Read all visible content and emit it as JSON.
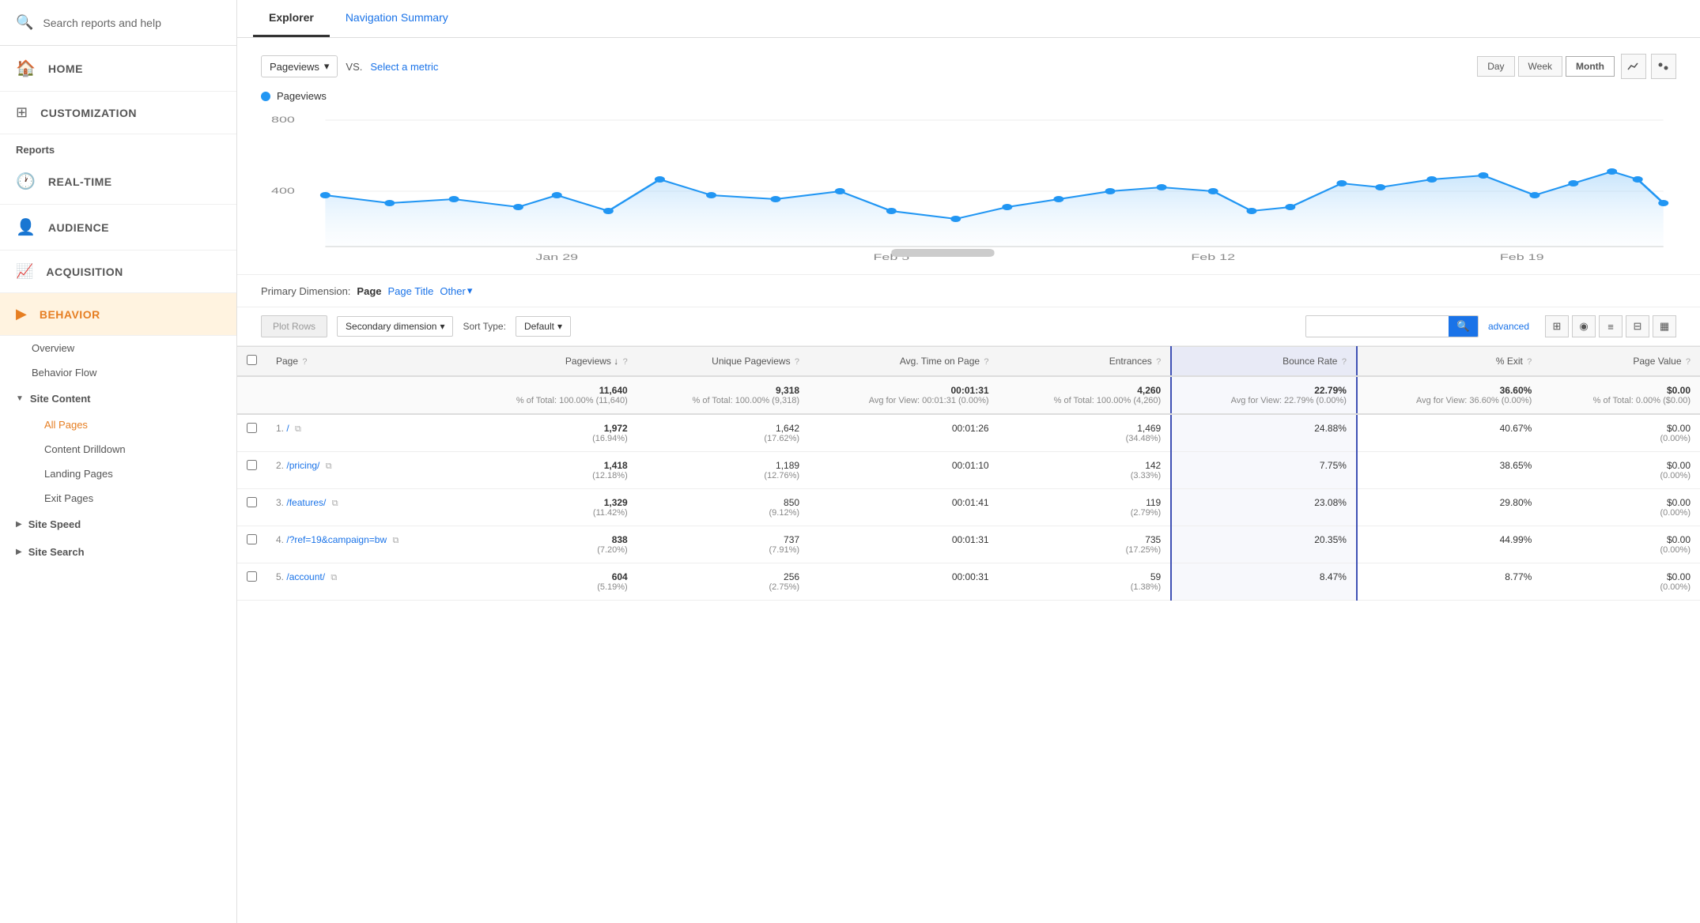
{
  "sidebar": {
    "search_placeholder": "Search reports and help",
    "nav_items": [
      {
        "id": "home",
        "label": "HOME",
        "icon": "🏠"
      },
      {
        "id": "customization",
        "label": "CUSTOMIZATION",
        "icon": "⊞"
      }
    ],
    "reports_label": "Reports",
    "report_sections": [
      {
        "id": "realtime",
        "label": "REAL-TIME",
        "icon": "🕐",
        "indent": 1
      },
      {
        "id": "audience",
        "label": "AUDIENCE",
        "icon": "👤",
        "indent": 1
      },
      {
        "id": "acquisition",
        "label": "ACQUISITION",
        "icon": "📈",
        "indent": 1
      },
      {
        "id": "behavior",
        "label": "BEHAVIOR",
        "icon": "▶",
        "indent": 1,
        "active": true
      }
    ],
    "behavior_items": [
      {
        "id": "overview",
        "label": "Overview"
      },
      {
        "id": "behavior-flow",
        "label": "Behavior Flow"
      }
    ],
    "site_content_label": "Site Content",
    "site_content_items": [
      {
        "id": "all-pages",
        "label": "All Pages",
        "active": true
      },
      {
        "id": "content-drilldown",
        "label": "Content Drilldown"
      },
      {
        "id": "landing-pages",
        "label": "Landing Pages"
      },
      {
        "id": "exit-pages",
        "label": "Exit Pages"
      }
    ],
    "site_speed_label": "Site Speed",
    "site_search_label": "Site Search"
  },
  "tabs": [
    {
      "id": "explorer",
      "label": "Explorer",
      "active": true
    },
    {
      "id": "navigation-summary",
      "label": "Navigation Summary",
      "active": false
    }
  ],
  "chart": {
    "metric_dropdown": "Pageviews",
    "vs_label": "VS.",
    "select_metric": "Select a metric",
    "time_buttons": [
      "Day",
      "Week",
      "Month"
    ],
    "active_time": "Month",
    "legend_label": "Pageviews",
    "y_label": "800",
    "y_label2": "400",
    "x_labels": [
      "Jan 29",
      "Feb 5",
      "Feb 12",
      "Feb 19"
    ],
    "chart_type_icons": [
      "📈",
      "⬤"
    ]
  },
  "primary_dimension": {
    "label": "Primary Dimension:",
    "options": [
      "Page",
      "Page Title",
      "Other"
    ],
    "active": "Page"
  },
  "table_controls": {
    "plot_rows_label": "Plot Rows",
    "secondary_dim_label": "Secondary dimension",
    "sort_type_label": "Sort Type:",
    "sort_default": "Default",
    "advanced_label": "advanced"
  },
  "table": {
    "headers": [
      {
        "id": "page",
        "label": "Page",
        "align": "left"
      },
      {
        "id": "pageviews",
        "label": "Pageviews",
        "align": "right",
        "sort": true
      },
      {
        "id": "unique-pageviews",
        "label": "Unique Pageviews",
        "align": "right"
      },
      {
        "id": "avg-time",
        "label": "Avg. Time on Page",
        "align": "right"
      },
      {
        "id": "entrances",
        "label": "Entrances",
        "align": "right"
      },
      {
        "id": "bounce-rate",
        "label": "Bounce Rate",
        "align": "right",
        "highlighted": true
      },
      {
        "id": "pct-exit",
        "label": "% Exit",
        "align": "right"
      },
      {
        "id": "page-value",
        "label": "Page Value",
        "align": "right"
      }
    ],
    "totals": {
      "page": "",
      "pageviews": "11,640",
      "pageviews_sub": "% of Total: 100.00% (11,640)",
      "unique_pageviews": "9,318",
      "unique_pageviews_sub": "% of Total: 100.00% (9,318)",
      "avg_time": "00:01:31",
      "avg_time_sub": "Avg for View: 00:01:31 (0.00%)",
      "entrances": "4,260",
      "entrances_sub": "% of Total: 100.00% (4,260)",
      "bounce_rate": "22.79%",
      "bounce_rate_sub": "Avg for View: 22.79% (0.00%)",
      "pct_exit": "36.60%",
      "pct_exit_sub": "Avg for View: 36.60% (0.00%)",
      "page_value": "$0.00",
      "page_value_sub": "% of Total: 0.00% ($0.00)"
    },
    "rows": [
      {
        "num": "1.",
        "page": "/",
        "pageviews": "1,972",
        "pageviews_pct": "(16.94%)",
        "unique_pv": "1,642",
        "unique_pv_pct": "(17.62%)",
        "avg_time": "00:01:26",
        "entrances": "1,469",
        "entrances_pct": "(34.48%)",
        "bounce_rate": "24.88%",
        "pct_exit": "40.67%",
        "page_value": "$0.00",
        "page_value_pct": "(0.00%)"
      },
      {
        "num": "2.",
        "page": "/pricing/",
        "pageviews": "1,418",
        "pageviews_pct": "(12.18%)",
        "unique_pv": "1,189",
        "unique_pv_pct": "(12.76%)",
        "avg_time": "00:01:10",
        "entrances": "142",
        "entrances_pct": "(3.33%)",
        "bounce_rate": "7.75%",
        "pct_exit": "38.65%",
        "page_value": "$0.00",
        "page_value_pct": "(0.00%)"
      },
      {
        "num": "3.",
        "page": "/features/",
        "pageviews": "1,329",
        "pageviews_pct": "(11.42%)",
        "unique_pv": "850",
        "unique_pv_pct": "(9.12%)",
        "avg_time": "00:01:41",
        "entrances": "119",
        "entrances_pct": "(2.79%)",
        "bounce_rate": "23.08%",
        "pct_exit": "29.80%",
        "page_value": "$0.00",
        "page_value_pct": "(0.00%)"
      },
      {
        "num": "4.",
        "page": "/?ref=19&campaign=bw",
        "pageviews": "838",
        "pageviews_pct": "(7.20%)",
        "unique_pv": "737",
        "unique_pv_pct": "(7.91%)",
        "avg_time": "00:01:31",
        "entrances": "735",
        "entrances_pct": "(17.25%)",
        "bounce_rate": "20.35%",
        "pct_exit": "44.99%",
        "page_value": "$0.00",
        "page_value_pct": "(0.00%)"
      },
      {
        "num": "5.",
        "page": "/account/",
        "pageviews": "604",
        "pageviews_pct": "(5.19%)",
        "unique_pv": "256",
        "unique_pv_pct": "(2.75%)",
        "avg_time": "00:00:31",
        "entrances": "59",
        "entrances_pct": "(1.38%)",
        "bounce_rate": "8.47%",
        "pct_exit": "8.77%",
        "page_value": "$0.00",
        "page_value_pct": "(0.00%)"
      }
    ]
  }
}
